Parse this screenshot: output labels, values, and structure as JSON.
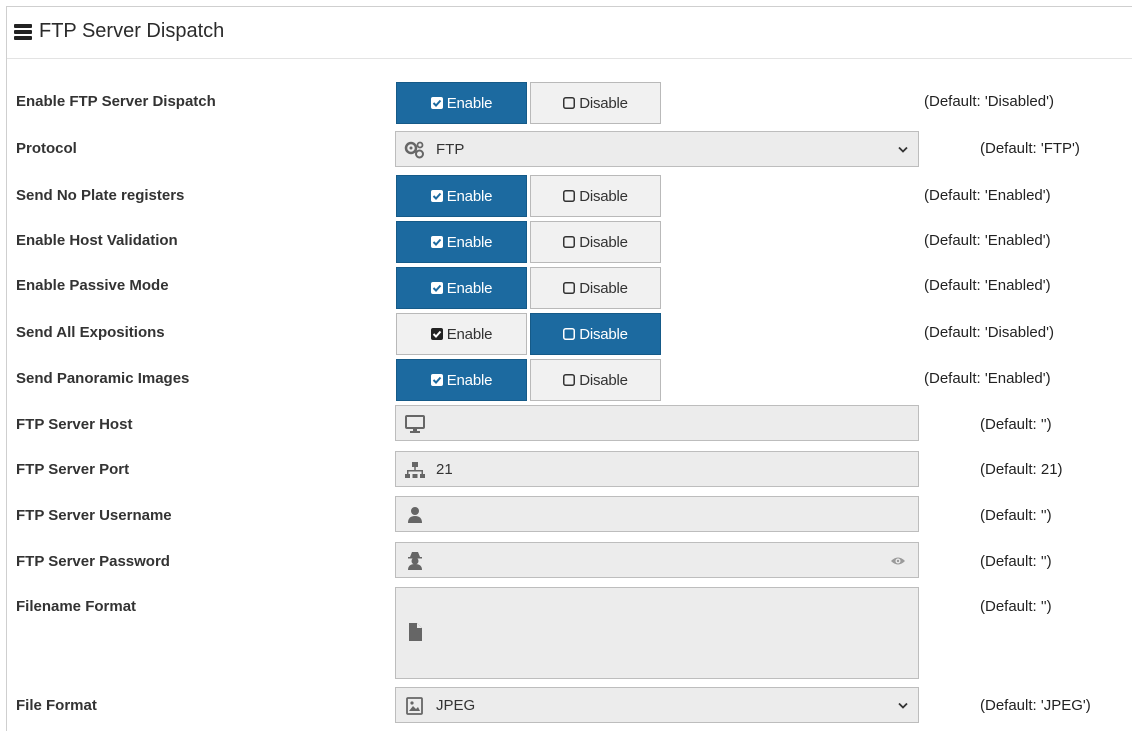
{
  "header": {
    "title": "FTP Server Dispatch",
    "icon": "server-stack-icon"
  },
  "toggle_labels": {
    "enable": "Enable",
    "disable": "Disable"
  },
  "colors": {
    "accent": "#1c6aa0",
    "inactive_bg": "#f1f1f1",
    "field_bg": "#ececec"
  },
  "rows": {
    "enable_dispatch": {
      "label": "Enable FTP Server Dispatch",
      "state": "enabled",
      "default": "(Default: 'Disabled')"
    },
    "protocol": {
      "label": "Protocol",
      "value": "FTP",
      "icon": "cogs-icon",
      "default": "(Default: 'FTP')"
    },
    "send_no_plate": {
      "label": "Send No Plate registers",
      "state": "enabled",
      "default": "(Default: 'Enabled')"
    },
    "host_validation": {
      "label": "Enable Host Validation",
      "state": "enabled",
      "default": "(Default: 'Enabled')"
    },
    "passive_mode": {
      "label": "Enable Passive Mode",
      "state": "enabled",
      "default": "(Default: 'Enabled')"
    },
    "send_all_expositions": {
      "label": "Send All Expositions",
      "state": "disabled",
      "default": "(Default: 'Disabled')"
    },
    "send_panoramic": {
      "label": "Send Panoramic Images",
      "state": "enabled",
      "default": "(Default: 'Enabled')"
    },
    "server_host": {
      "label": "FTP Server Host",
      "value": "",
      "icon": "desktop-icon",
      "default": "(Default: '')"
    },
    "server_port": {
      "label": "FTP Server Port",
      "value": "21",
      "icon": "sitemap-icon",
      "default": "(Default: 21)"
    },
    "username": {
      "label": "FTP Server Username",
      "value": "",
      "icon": "user-icon",
      "default": "(Default: '')"
    },
    "password": {
      "label": "FTP Server Password",
      "value": "",
      "icon": "user-secret-icon",
      "reveal_icon": "eye-icon",
      "default": "(Default: '')"
    },
    "filename_format": {
      "label": "Filename Format",
      "value": "",
      "icon": "file-icon",
      "default": "(Default: '')"
    },
    "file_format": {
      "label": "File Format",
      "value": "JPEG",
      "icon": "image-icon",
      "default": "(Default: 'JPEG')"
    }
  }
}
